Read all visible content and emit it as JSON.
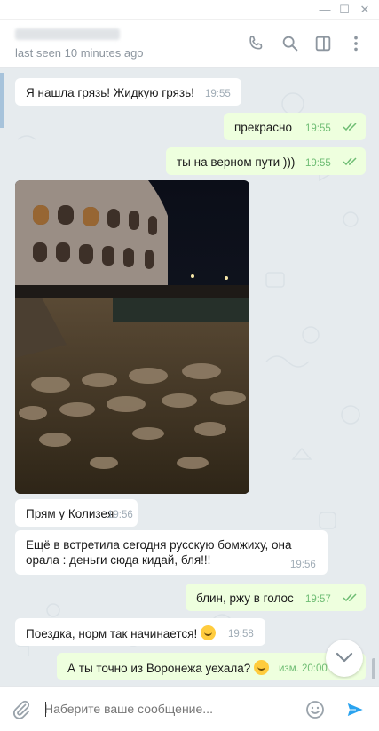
{
  "window": {
    "minimize": "—",
    "maximize": "☐",
    "close": "✕"
  },
  "header": {
    "status": "last seen 10 minutes ago",
    "icons": [
      "phone-icon",
      "search-icon",
      "sidebar-toggle-icon",
      "more-vertical-icon"
    ]
  },
  "messages": [
    {
      "direction": "in",
      "text": "Я нашла грязь! Жидкую грязь!",
      "time": "19:55"
    },
    {
      "direction": "out",
      "text": "прекрасно",
      "time": "19:55"
    },
    {
      "direction": "out",
      "text": "ты на верном пути )))",
      "time": "19:55"
    },
    {
      "direction": "in",
      "type": "photo",
      "subject": "photo-colosseum-night"
    },
    {
      "direction": "in",
      "text": "Прям у Колизея",
      "time": "19:56"
    },
    {
      "direction": "in",
      "text_line1": "Ещё в встретила сегодня русскую бомжиху, она",
      "text_line2": "орала : деньги сюда кидай, бля!!!",
      "time": "19:56"
    },
    {
      "direction": "out",
      "text": "блин, ржу в голос",
      "time": "19:57"
    },
    {
      "direction": "in",
      "text": "Поездка, норм так начинается!",
      "time": "19:58"
    },
    {
      "direction": "out",
      "text": "А ты точно из Воронежа уехала?",
      "time": "изм. 20:00"
    }
  ],
  "composer": {
    "placeholder": "Наберите ваше сообщение..."
  },
  "colors": {
    "accent": "#2aa3ef",
    "outgoing_bubble": "#eeffde",
    "incoming_bubble": "#ffffff",
    "background": "#e6ebee",
    "read_ticks": "#6fbd74"
  }
}
